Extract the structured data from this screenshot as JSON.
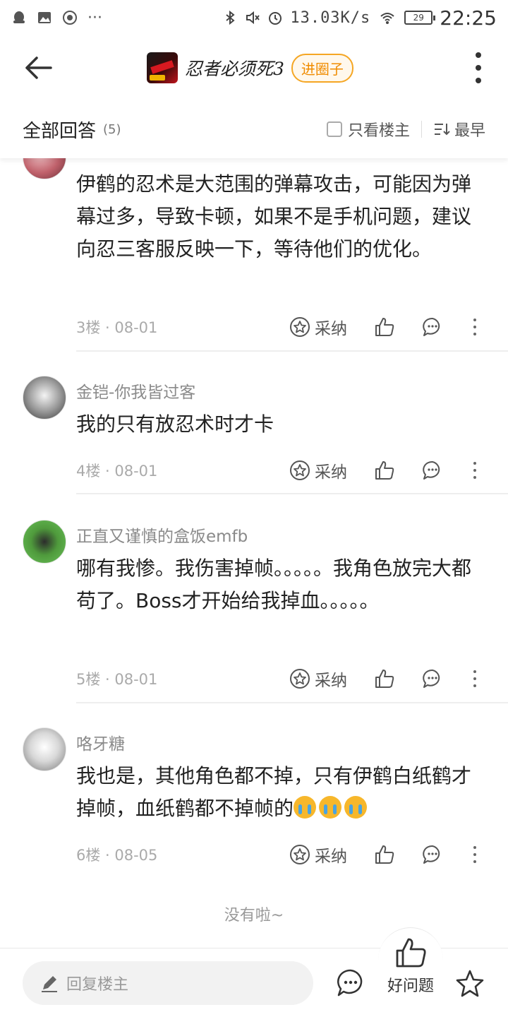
{
  "status_bar": {
    "speed": "13.03K/s",
    "battery": "29",
    "time": "22:25",
    "icons": [
      "qq-icon",
      "image-icon",
      "record-icon",
      "more-dots-icon",
      "bluetooth-icon",
      "mute-icon",
      "alarm-icon",
      "wifi-icon",
      "battery-icon"
    ]
  },
  "header": {
    "title": "忍者必须死3",
    "join_label": "进圈子"
  },
  "answers_bar": {
    "title": "全部回答",
    "count": "(5)",
    "only_host_label": "只看楼主",
    "sort_label": "最早"
  },
  "answers": [
    {
      "username": "",
      "text": "伊鹤的忍术是大范围的弹幕攻击，可能因为弹幕过多，导致卡顿，如果不是手机问题，建议向忍三客服反映一下，等待他们的优化。",
      "floor": "3楼 · 08-01",
      "adopt_label": "采纳"
    },
    {
      "username": "金铠-你我皆过客",
      "text": "我的只有放忍术时才卡",
      "floor": "4楼 · 08-01",
      "adopt_label": "采纳"
    },
    {
      "username": "正直又谨慎的盒饭emfb",
      "text": "哪有我惨。我伤害掉帧。。。。。我角色放完大都苟了。Boss才开始给我掉血。。。。。",
      "floor": "5楼 · 08-01",
      "adopt_label": "采纳"
    },
    {
      "username": "咯牙糖",
      "text": "我也是，其他角色都不掉，只有伊鹤白纸鹤才掉帧，血纸鹤都不掉帧的",
      "floor": "6楼 · 08-05",
      "adopt_label": "采纳"
    }
  ],
  "end_text": "没有啦~",
  "bottom_bar": {
    "reply_placeholder": "回复楼主",
    "good_question_label": "好问题"
  },
  "colors": {
    "accent_orange": "#f08c00",
    "text_primary": "#222222",
    "text_muted": "#999999"
  }
}
